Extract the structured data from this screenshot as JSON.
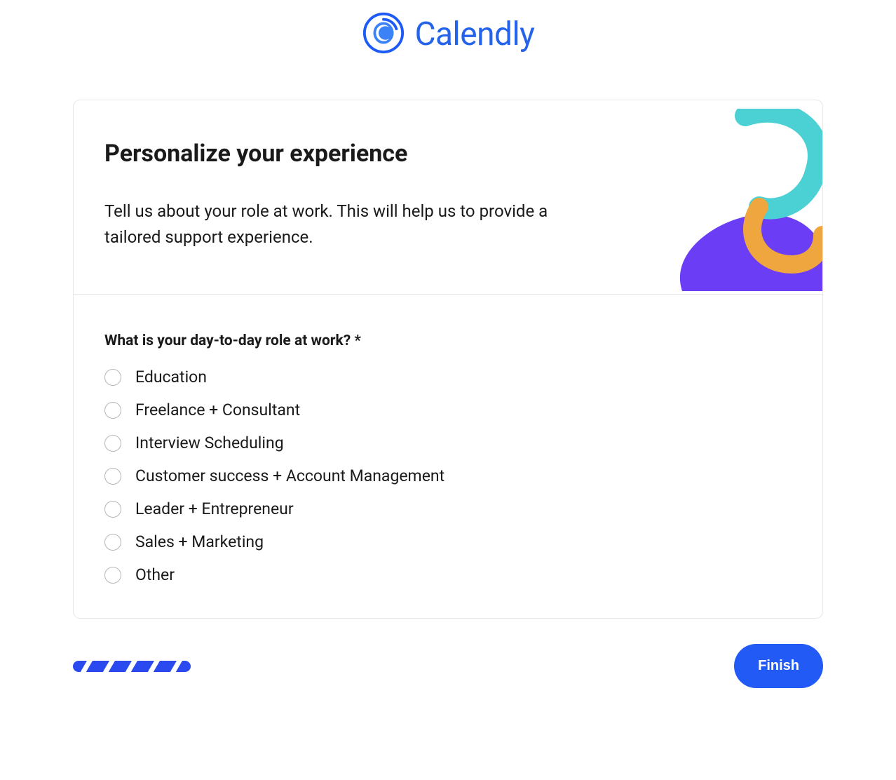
{
  "brand": {
    "name": "Calendly"
  },
  "header": {
    "title": "Personalize your experience",
    "subtitle": "Tell us about your role at work. This will help us to provide a tailored support experience."
  },
  "question": {
    "label": "What is your day-to-day role at work? *",
    "options": [
      {
        "label": "Education"
      },
      {
        "label": "Freelance + Consultant"
      },
      {
        "label": "Interview Scheduling"
      },
      {
        "label": "Customer success + Account Management"
      },
      {
        "label": "Leader + Entrepreneur"
      },
      {
        "label": "Sales + Marketing"
      },
      {
        "label": "Other"
      }
    ]
  },
  "footer": {
    "finish_label": "Finish"
  },
  "colors": {
    "primary": "#225af6",
    "accent_teal": "#4bd0d4",
    "accent_purple": "#6b3df5",
    "accent_orange": "#f0a63e"
  }
}
